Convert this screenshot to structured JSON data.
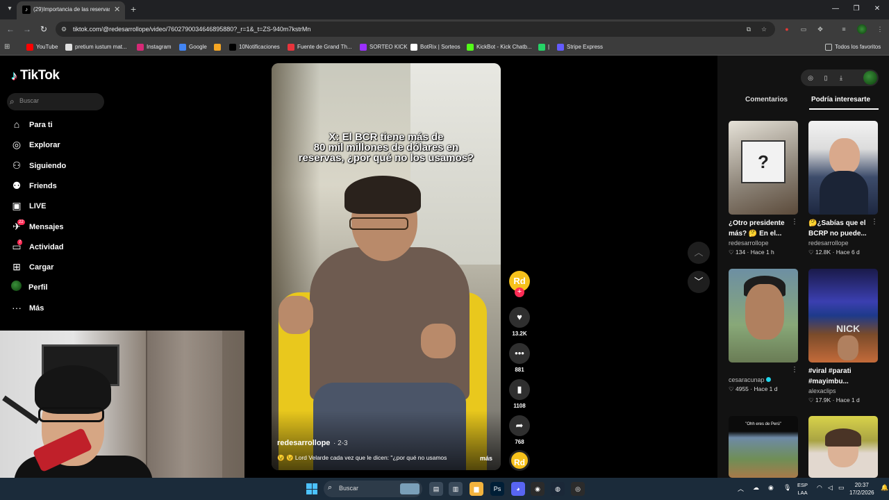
{
  "browser": {
    "tab_title": "(29)Importancia de las reservas",
    "tab_close": "✕",
    "new_tab": "+",
    "url": "tiktok.com/@redesarrollope/video/7602790034646895880?_r=1&_t=ZS-940m7kstrMn",
    "window_controls": {
      "minimize": "—",
      "restore": "❐",
      "close": "✕"
    },
    "bookmarks": [
      {
        "label": "YouTube",
        "icon_color": "#ff0000"
      },
      {
        "label": "pretium iustum mat...",
        "icon_color": "#e0e0e0"
      },
      {
        "label": "Instagram",
        "icon_color": "#d62976"
      },
      {
        "label": "Google",
        "icon_color": "#4285f4"
      },
      {
        "label": "",
        "icon_color": "#f5a623"
      },
      {
        "label": "10Notificaciones",
        "icon_color": "#000000"
      },
      {
        "label": "Fuente de Grand Th...",
        "icon_color": "#e8343c"
      },
      {
        "label": "SORTEO KICK",
        "icon_color": "#9b30ff"
      },
      {
        "label": "BotRix | Sorteos",
        "icon_color": "#ffffff"
      },
      {
        "label": "KickBot - Kick Chatb...",
        "icon_color": "#53fc18"
      },
      {
        "label": "|",
        "icon_color": "#25d366"
      },
      {
        "label": "Stripe Express",
        "icon_color": "#635bff"
      }
    ],
    "all_bookmarks": "Todos los favoritos"
  },
  "tiktok": {
    "logo": "TikTok",
    "search_placeholder": "Buscar",
    "nav": [
      {
        "label": "Para ti",
        "icon": "home-icon",
        "glyph": "⌂"
      },
      {
        "label": "Explorar",
        "icon": "compass-icon",
        "glyph": "◎"
      },
      {
        "label": "Siguiendo",
        "icon": "following-icon",
        "glyph": "⚇"
      },
      {
        "label": "Friends",
        "icon": "friends-icon",
        "glyph": "⚉"
      },
      {
        "label": "LIVE",
        "icon": "live-icon",
        "glyph": "▣"
      },
      {
        "label": "Mensajes",
        "icon": "messages-icon",
        "glyph": "✈",
        "badge": "22"
      },
      {
        "label": "Actividad",
        "icon": "activity-icon",
        "glyph": "▭",
        "badge": "7"
      },
      {
        "label": "Cargar",
        "icon": "upload-icon",
        "glyph": "⊞"
      },
      {
        "label": "Perfil",
        "icon": "profile-avatar",
        "glyph": ""
      },
      {
        "label": "Más",
        "icon": "more-icon",
        "glyph": "···"
      }
    ],
    "video": {
      "caption_lines": [
        "X: El BCR tiene más de",
        "80 mil millones de dólares en",
        "reservas, ¿por qué no los usamos?"
      ],
      "author": "redesarrollope",
      "date": "· 2-3",
      "description": "😉 😉 Lord Velarde cada vez que le dicen: \"¿por qué no usamos",
      "more": "más"
    },
    "actions": {
      "avatar": "Rd",
      "likes": "13.2K",
      "comments": "881",
      "saves": "1108",
      "shares": "768",
      "sound": "Rd"
    },
    "right_panel": {
      "tabs": [
        "Comentarios",
        "Podría interesarte"
      ],
      "cards": [
        {
          "title": "¿Otro presidente más? 🤔 En el...",
          "user": "redesarrollope",
          "likes": "134",
          "time": "Hace 1 h",
          "thumb_text": "?"
        },
        {
          "title": "🤔¿Sabías que el BCRP no puede...",
          "user": "redesarrollope",
          "likes": "12.8K",
          "time": "Hace 6 d",
          "thumb_text": ""
        },
        {
          "title": "",
          "user": "cesaracunap",
          "likes": "4955",
          "time": "Hace 1 d",
          "thumb_text": ""
        },
        {
          "title": "#viral #parati #mayimbu...",
          "user": "alexaclips",
          "likes": "17.9K",
          "time": "Hace 1 d",
          "thumb_text": "NICK"
        },
        {
          "title": "",
          "user": "",
          "likes": "",
          "time": "",
          "thumb_text": "\"Ohh eres de Perú\""
        },
        {
          "title": "",
          "user": "",
          "likes": "",
          "time": "",
          "thumb_text": ""
        }
      ]
    }
  },
  "taskbar": {
    "search_label": "Buscar",
    "lang_line1": "ESP",
    "lang_line2": "LAA",
    "time": "20:37",
    "date": "17/2/2026",
    "apps": [
      {
        "name": "file-explorer",
        "glyph": "▤",
        "color": "#3a4a5a"
      },
      {
        "name": "task-view",
        "glyph": "▥",
        "color": "#3a4a5a"
      },
      {
        "name": "folder",
        "glyph": "▆",
        "color": "#f3b33d"
      },
      {
        "name": "photoshop",
        "glyph": "Ps",
        "color": "#001e36"
      },
      {
        "name": "discord",
        "glyph": "◕",
        "color": "#5865f2"
      },
      {
        "name": "chrome",
        "glyph": "◉",
        "color": "#2b2b2b"
      },
      {
        "name": "steam",
        "glyph": "◍",
        "color": "#1b2838"
      },
      {
        "name": "obs",
        "glyph": "◎",
        "color": "#2b2b2b"
      }
    ]
  }
}
